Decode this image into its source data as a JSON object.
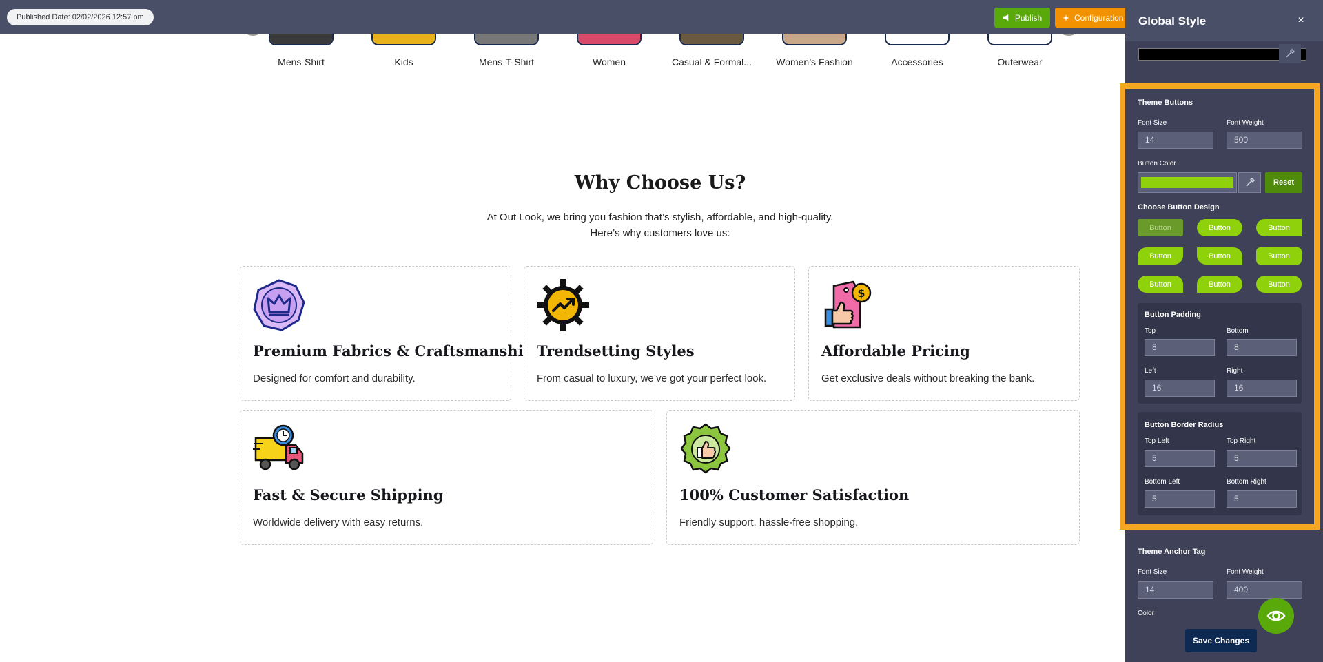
{
  "topbar": {
    "published_date": "Published Date: 02/02/2026 12:57 pm",
    "publish_label": "Publish",
    "config_label": "Configuration"
  },
  "categories": [
    {
      "label": "Mens-Shirt",
      "color": "#3a3a3a"
    },
    {
      "label": "Kids",
      "color": "#e8b21a"
    },
    {
      "label": "Mens-T-Shirt",
      "color": "#777777"
    },
    {
      "label": "Women",
      "color": "#d94a6a"
    },
    {
      "label": "Casual & Formal...",
      "color": "#6a5a40"
    },
    {
      "label": "Women’s Fashion",
      "color": "#c9a88a"
    },
    {
      "label": "Accessories",
      "color": "#ffffff"
    },
    {
      "label": "Outerwear",
      "color": "#ffffff"
    }
  ],
  "why": {
    "title": "Why Choose Us?",
    "subtitle_line1": "At Out Look, we bring you fashion that’s stylish, affordable, and high-quality.",
    "subtitle_line2": "Here’s why customers love us:",
    "cards": [
      {
        "icon": "crown-icon",
        "title": "Premium Fabrics & Craftsmanship",
        "desc": "Designed for comfort and durability."
      },
      {
        "icon": "trend-gear-icon",
        "title": "Trendsetting Styles",
        "desc": "From casual to luxury, we’ve got your perfect look."
      },
      {
        "icon": "price-tag-thumb-icon",
        "title": "Affordable Pricing",
        "desc": "Get exclusive deals without breaking the bank."
      },
      {
        "icon": "delivery-truck-icon",
        "title": "Fast & Secure Shipping",
        "desc": "Worldwide delivery with easy returns."
      },
      {
        "icon": "satisfaction-badge-icon",
        "title": "100% Customer Satisfaction",
        "desc": "Friendly support, hassle-free shopping."
      }
    ]
  },
  "panel": {
    "title": "Global Style",
    "close": "×",
    "theme_buttons": {
      "heading": "Theme Buttons",
      "font_size_label": "Font Size",
      "font_size": "14",
      "font_weight_label": "Font Weight",
      "font_weight": "500",
      "button_color_label": "Button Color",
      "button_color": "#8fd10b",
      "reset_label": "Reset",
      "design_label": "Choose Button Design",
      "design_button_label": "Button",
      "padding": {
        "heading": "Button Padding",
        "top_label": "Top",
        "top": "8",
        "bottom_label": "Bottom",
        "bottom": "8",
        "left_label": "Left",
        "left": "16",
        "right_label": "Right",
        "right": "16"
      },
      "radius": {
        "heading": "Button Border Radius",
        "tl_label": "Top Left",
        "tl": "5",
        "tr_label": "Top Right",
        "tr": "5",
        "bl_label": "Bottom Left",
        "bl": "5",
        "br_label": "Bottom Right",
        "br": "5"
      }
    },
    "anchor": {
      "heading": "Theme Anchor Tag",
      "font_size_label": "Font Size",
      "font_size": "14",
      "font_weight_label": "Font Weight",
      "font_weight": "400",
      "color_label": "Color"
    },
    "save_label": "Save Changes"
  }
}
